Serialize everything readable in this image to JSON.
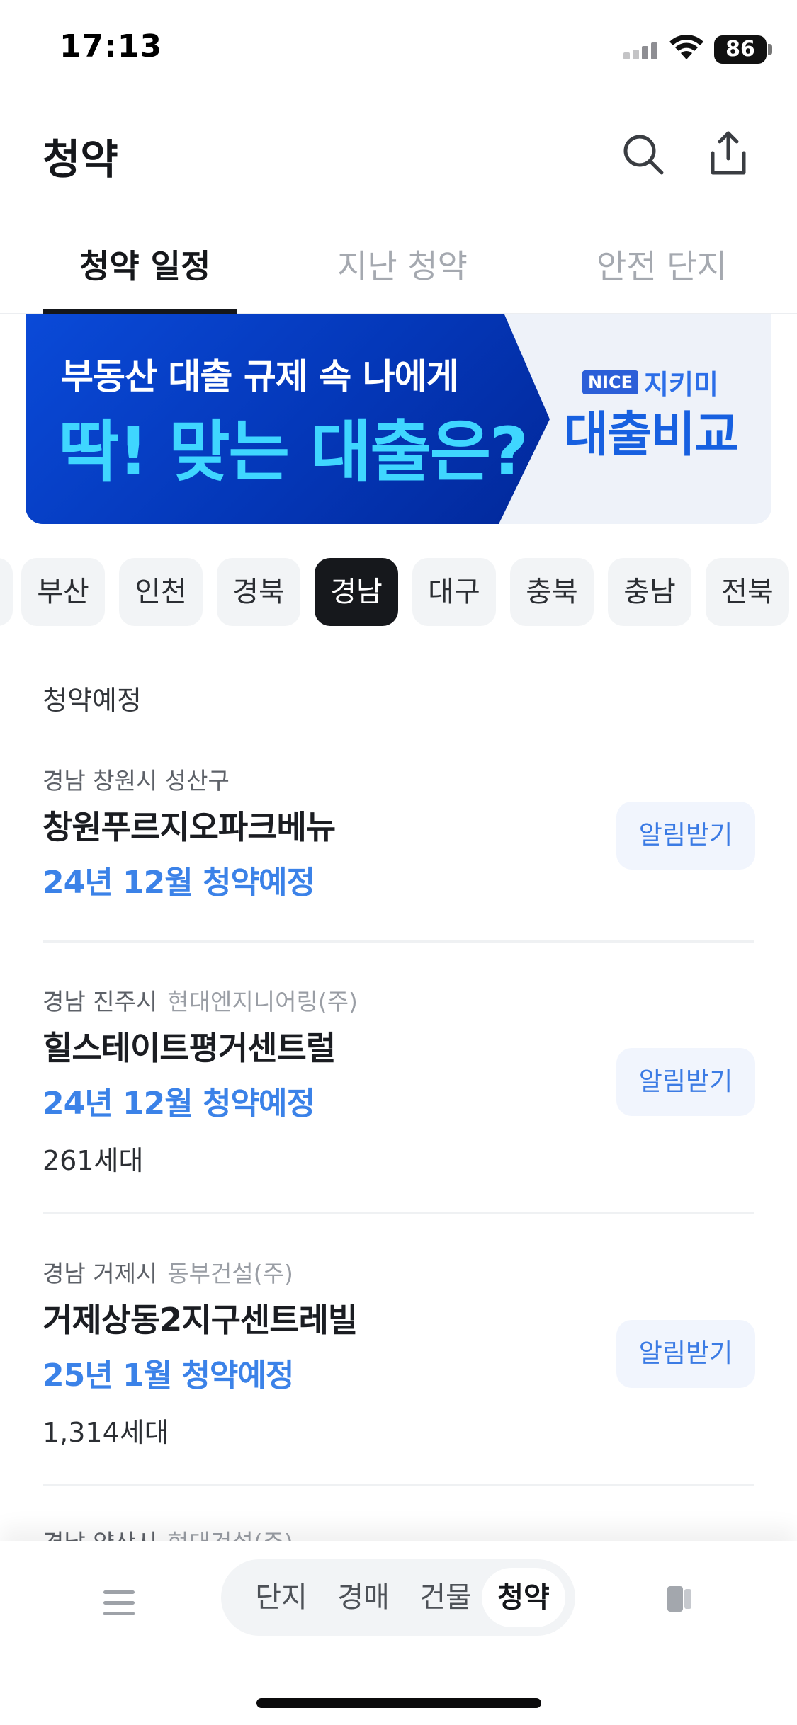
{
  "status_bar": {
    "time": "17:13",
    "battery": "86"
  },
  "header": {
    "title": "청약"
  },
  "tabs": [
    {
      "label": "청약 일정"
    },
    {
      "label": "지난 청약"
    },
    {
      "label": "안전 단지"
    }
  ],
  "banner": {
    "line1": "부동산 대출 규제 속 나에게",
    "line2": "딱! 맞는 대출은?",
    "badge": "NICE",
    "brand": "지키미",
    "cta": "대출비교"
  },
  "regions": {
    "items": [
      "부산",
      "인천",
      "경북",
      "경남",
      "대구",
      "충북",
      "충남",
      "전북"
    ],
    "selected": "경남"
  },
  "list": {
    "section_label": "청약예정",
    "notify_label": "알림받기",
    "items": [
      {
        "location": "경남 창원시 성산구",
        "builder": "",
        "name": "창원푸르지오파크베뉴",
        "date": "24년 12월 청약예정",
        "units": ""
      },
      {
        "location": "경남 진주시",
        "builder": "현대엔지니어링(주)",
        "name": "힐스테이트평거센트럴",
        "date": "24년 12월 청약예정",
        "units": "261세대"
      },
      {
        "location": "경남 거제시",
        "builder": "동부건설(주)",
        "name": "거제상동2지구센트레빌",
        "date": "25년 1월 청약예정",
        "units": "1,314세대"
      }
    ],
    "peek": {
      "location": "경남 양산시",
      "builder": "현대건설(주)"
    }
  },
  "bottom_nav": {
    "items": [
      "단지",
      "경매",
      "건물",
      "청약"
    ],
    "active": "청약"
  },
  "colors": {
    "accent": "#3b82e8",
    "chip_active": "#16181c",
    "banner_blue": "#0437b8",
    "banner_cyan": "#3fd6ff"
  }
}
